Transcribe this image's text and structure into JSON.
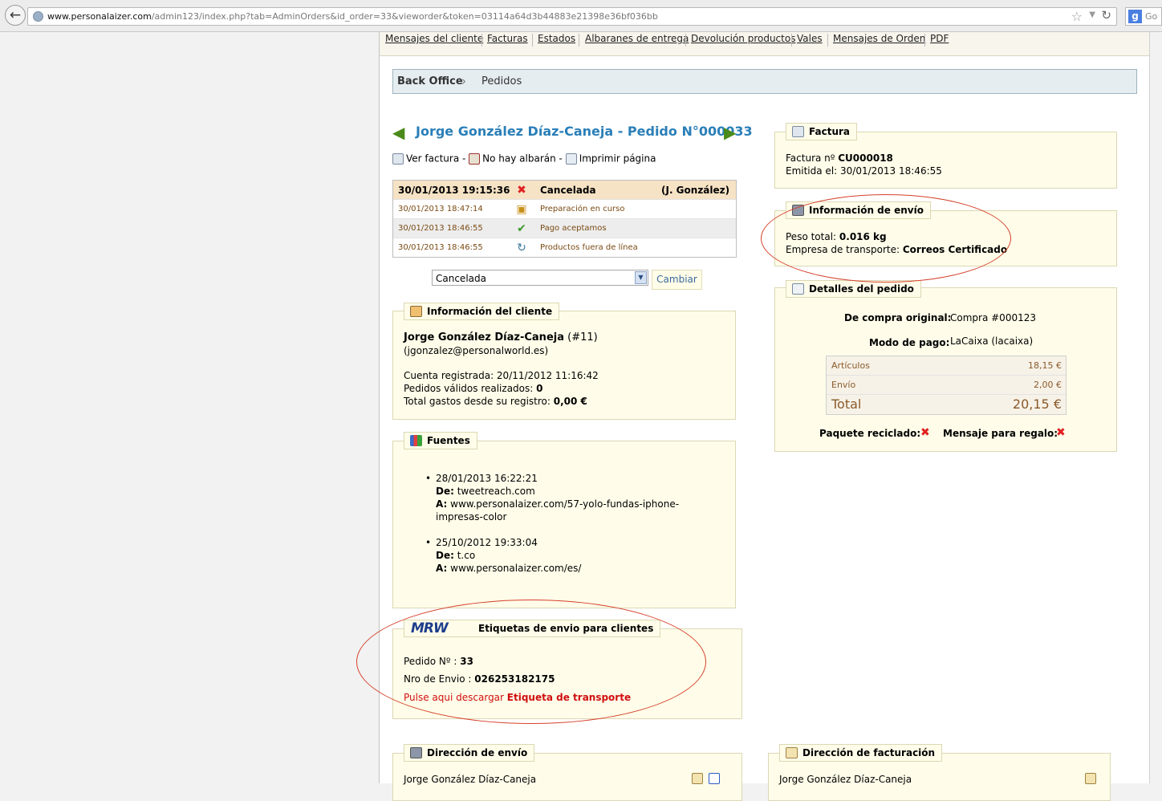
{
  "browser": {
    "url_host": "www.personalaizer.com",
    "url_path": "/admin123/index.php?tab=AdminOrders&id_order=33&vieworder&token=03114a64d3b44883e21398e36bf036bb",
    "search_label": "Go"
  },
  "tabs": [
    {
      "label": "Mensajes del cliente"
    },
    {
      "label": "Facturas"
    },
    {
      "label": "Estados"
    },
    {
      "label": "Albaranes de entrega"
    },
    {
      "label": "Devolución productos"
    },
    {
      "label": "Vales"
    },
    {
      "label": "Mensajes de Orden"
    },
    {
      "label": "PDF"
    }
  ],
  "breadcrumb": {
    "root": "Back Office",
    "current": "Pedidos"
  },
  "order": {
    "title": "Jorge González Díaz-Caneja - Pedido N°000033",
    "actions": {
      "invoice": "Ver factura",
      "sep1": " - ",
      "no_delivery": "No hay albarán",
      "sep2": " - ",
      "print": "Imprimir página"
    }
  },
  "history": [
    {
      "date": "30/01/2013 19:15:36",
      "status": "Cancelada",
      "user": "(J. González)"
    },
    {
      "date": "30/01/2013 18:47:14",
      "status": "Preparación en curso",
      "user": ""
    },
    {
      "date": "30/01/2013 18:46:55",
      "status": "Pago aceptamos",
      "user": ""
    },
    {
      "date": "30/01/2013 18:46:55",
      "status": "Productos fuera de línea",
      "user": ""
    }
  ],
  "status_select": {
    "value": "Cancelada",
    "button": "Cambiar"
  },
  "customer": {
    "legend": "Información del cliente",
    "name": "Jorge González Díaz-Caneja",
    "id": " (#11)",
    "email": "(jgonzalez@personalworld.es)",
    "registered_label": "Cuenta registrada: ",
    "registered": "20/11/2012 11:16:42",
    "orders_label": "Pedidos válidos realizados: ",
    "orders": "0",
    "spent_label": "Total gastos desde su registro: ",
    "spent": "0,00 €"
  },
  "sources": {
    "legend": "Fuentes",
    "items": [
      {
        "date": "28/01/2013 16:22:21",
        "from_label": "De:",
        "from": " tweetreach.com",
        "to_label": "A:",
        "to": " www.personalaizer.com/57-yolo-fundas-iphone-",
        "to2": "impresas-color"
      },
      {
        "date": "25/10/2012 19:33:04",
        "from_label": "De:",
        "from": " t.co",
        "to_label": "A:",
        "to": " www.personalaizer.com/es/",
        "to2": ""
      }
    ]
  },
  "mrw": {
    "logo_text": "MRW",
    "legend": "Etiquetas de envio para clientes",
    "order_label": "Pedido Nº : ",
    "order": "33",
    "shipment_label": "Nro de Envio : ",
    "shipment": "026253182175",
    "download_label": "Pulse aqui descargar ",
    "download_link": "Etiqueta de transporte"
  },
  "invoice": {
    "legend": "Factura",
    "number_label": "Factura nº ",
    "number": "CU000018",
    "issued_label": "Emitida el: ",
    "issued": "30/01/2013 18:46:55"
  },
  "shipping": {
    "legend": "Información de envío",
    "weight_label": "Peso total: ",
    "weight": "0.016 kg",
    "carrier_label": "Empresa de transporte: ",
    "carrier": "Correos Certificado"
  },
  "details": {
    "legend": "Detalles del pedido",
    "source_label": "De compra original:",
    "source": "Compra #000123",
    "payment_label": "Modo de pago:",
    "payment": "LaCaixa (lacaixa)",
    "rows": [
      {
        "label": "Artículos",
        "value": "18,15 €"
      },
      {
        "label": "Envío",
        "value": "2,00 €"
      },
      {
        "label": "Total",
        "value": "20,15 €"
      }
    ],
    "recycled_label": "Paquete reciclado:",
    "gift_label": "Mensaje para regalo:",
    "recycled_icon": "x-icon",
    "gift_icon": "x-icon"
  },
  "delivery_address": {
    "legend": "Dirección de envío",
    "name": "Jorge González Díaz-Caneja"
  },
  "billing_address": {
    "legend": "Dirección de facturación",
    "name": "Jorge González Díaz-Caneja"
  },
  "colors": {
    "title": "#2a7fb8",
    "annotation": "#d6402a",
    "panel": "#fffde9"
  }
}
